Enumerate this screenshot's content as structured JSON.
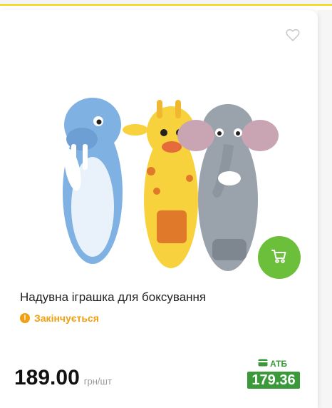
{
  "product": {
    "title": "Надувна іграшка для боксування",
    "status": "Закінчується",
    "price": "189.00",
    "unit": "грн/шт",
    "loyalty_label": "АТБ",
    "loyalty_price": "179.36"
  },
  "colors": {
    "accent_green": "#6bbf3a",
    "loyalty_green": "#3a9a3a",
    "warning_orange": "#f0a010"
  },
  "icons": {
    "favorite": "heart-icon",
    "cart": "cart-icon",
    "status": "exclamation-icon",
    "loyalty": "card-icon"
  }
}
